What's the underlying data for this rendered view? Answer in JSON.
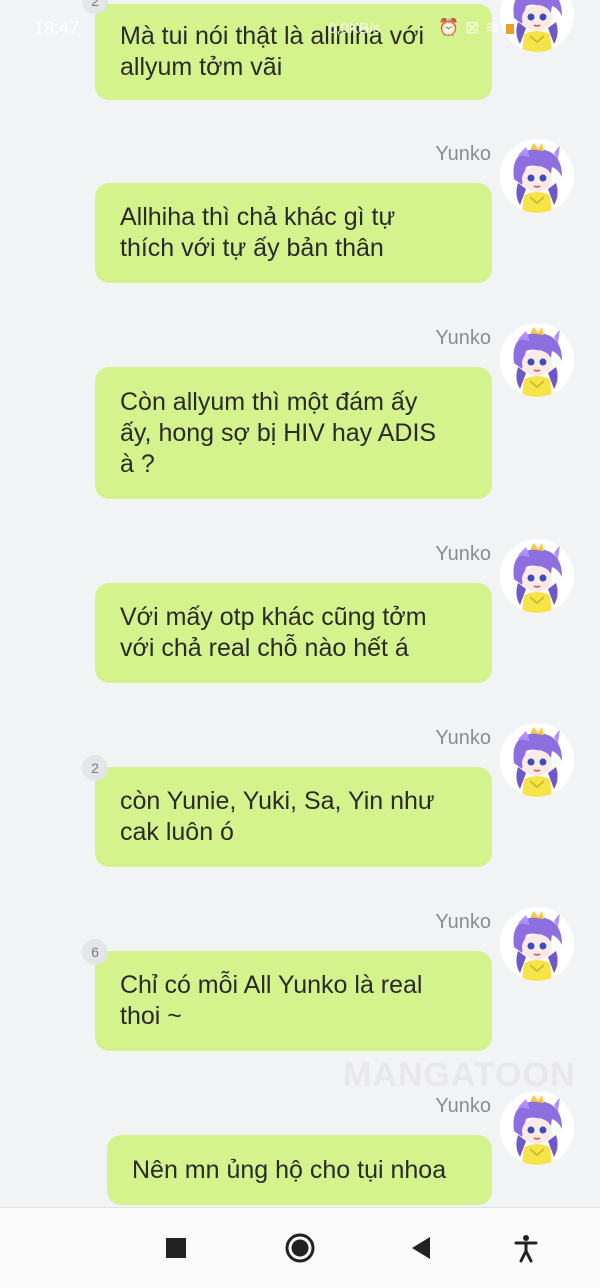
{
  "status_bar": {
    "time": "18:47",
    "speed": "6,0KB/s",
    "icons": [
      "alarm-icon",
      "close-box-icon",
      "wifi-icon",
      "battery-icon"
    ]
  },
  "messages": [
    {
      "sender": "",
      "text_lines": [
        "Mà tui nói thật là allhiha với",
        "allyum tởm vãi"
      ],
      "badge": "2"
    },
    {
      "sender": "Yunko",
      "text_lines": [
        "Allhiha thì chả khác gì tự",
        "thích với tự ấy bản thân"
      ],
      "badge": ""
    },
    {
      "sender": "Yunko",
      "text_lines": [
        "Còn allyum thì một đám ấy",
        "ấy, hong sợ bị HIV hay ADIS",
        "à ?"
      ],
      "badge": ""
    },
    {
      "sender": "Yunko",
      "text_lines": [
        "Với mấy otp khác cũng tởm",
        "với chả real chỗ nào hết á"
      ],
      "badge": ""
    },
    {
      "sender": "Yunko",
      "text_lines": [
        "còn Yunie, Yuki, Sa, Yin như",
        "cak luôn ó"
      ],
      "badge": "2"
    },
    {
      "sender": "Yunko",
      "text_lines": [
        "Chỉ có mỗi All Yunko là real",
        "thoi ~"
      ],
      "badge": "6"
    },
    {
      "sender": "Yunko",
      "text_lines": [
        "Nên mn ủng hộ cho tụi nhoa"
      ],
      "badge": ""
    }
  ],
  "watermark": "MANGATOON",
  "nav_bar": {
    "buttons": [
      "recents-square-icon",
      "home-circle-icon",
      "back-triangle-icon",
      "accessibility-icon"
    ]
  },
  "colors": {
    "background": "#f2f3f5",
    "bubble": "#d4f38d",
    "sender": "#8c8c8c",
    "text": "#2a2a2a"
  }
}
